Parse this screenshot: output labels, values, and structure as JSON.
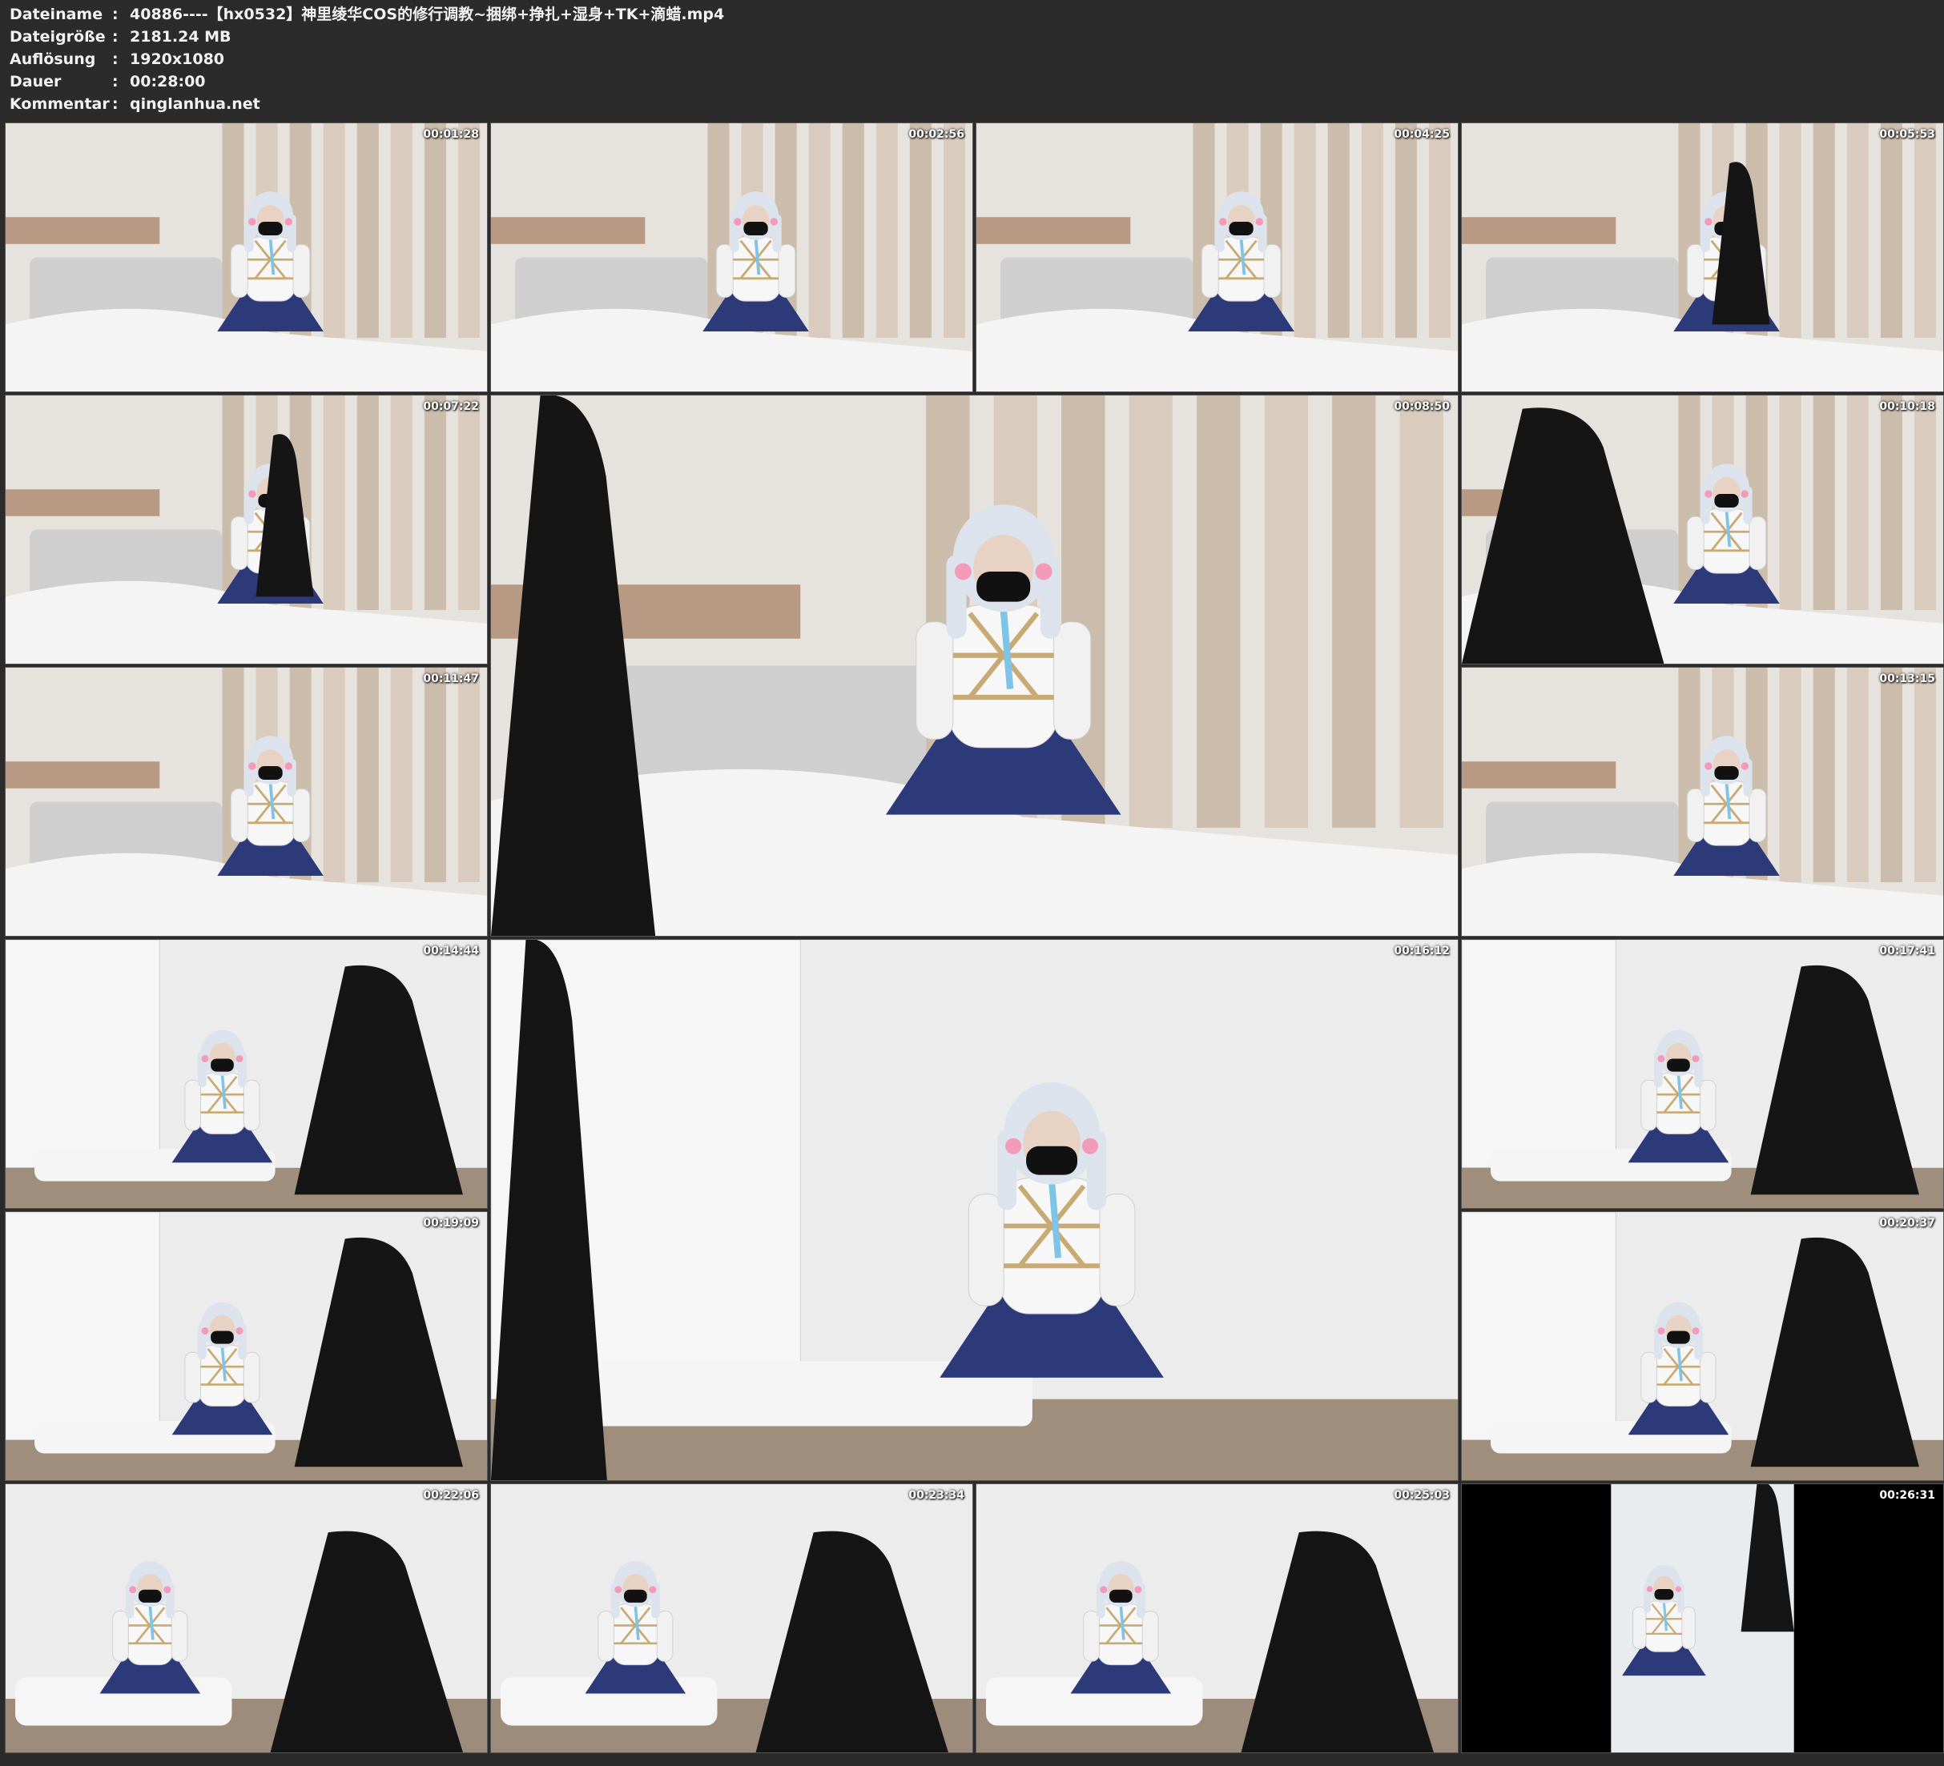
{
  "meta": [
    {
      "label": "Dateiname",
      "value": "40886----【hx0532】神里绫华COS的修行调教~捆绑+挣扎+湿身+TK+滴蜡.mp4"
    },
    {
      "label": "Dateigröße",
      "value": "2181.24 MB"
    },
    {
      "label": "Auflösung",
      "value": "1920x1080"
    },
    {
      "label": "Dauer",
      "value": "00:28:00"
    },
    {
      "label": "Kommentar",
      "value": "qinglanhua.net"
    }
  ],
  "frames": [
    {
      "time": "00:01:28",
      "scene": "bedroom"
    },
    {
      "time": "00:02:56",
      "scene": "bedroom"
    },
    {
      "time": "00:04:25",
      "scene": "bedroom"
    },
    {
      "time": "00:05:53",
      "scene": "bedroom"
    },
    {
      "time": "00:07:22",
      "scene": "bedroom"
    },
    {
      "time": "00:08:50",
      "scene": "closeup"
    },
    {
      "time": "00:10:18",
      "scene": "bedroom"
    },
    {
      "time": "00:11:47",
      "scene": "bedroom"
    },
    {
      "time": "00:13:15",
      "scene": "bedroom"
    },
    {
      "time": "00:14:44",
      "scene": "wall"
    },
    {
      "time": "00:16:12",
      "scene": "wall"
    },
    {
      "time": "00:17:41",
      "scene": "wall"
    },
    {
      "time": "00:19:09",
      "scene": "wall"
    },
    {
      "time": "00:20:37",
      "scene": "wall"
    },
    {
      "time": "00:22:06",
      "scene": "floor"
    },
    {
      "time": "00:23:34",
      "scene": "floor"
    },
    {
      "time": "00:25:03",
      "scene": "floor"
    },
    {
      "time": "00:26:31",
      "scene": "bathroom"
    }
  ],
  "colors": {
    "background": "#2b2b2b",
    "header_text": "#f2f2f2",
    "curtain": "#d8cbbd",
    "wall": "#ececec",
    "bed": "#f4f4f4",
    "skirt": "#2c3a7a",
    "wig": "#dde3ec"
  }
}
